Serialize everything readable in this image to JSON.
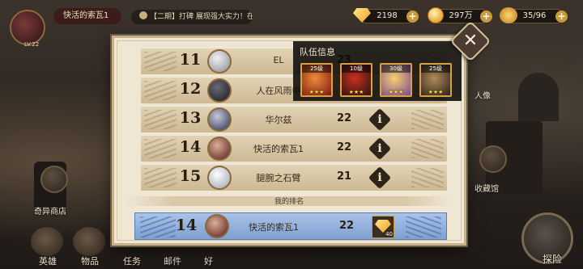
{
  "top": {
    "player_name": "快活的索瓦1",
    "player_level": "LV.22",
    "marquee": "【二期】打碑 展现强大实力！在"
  },
  "resources": [
    {
      "icon": "gem-icon",
      "value": "2198"
    },
    {
      "icon": "gold-coin-icon",
      "value": "297万"
    },
    {
      "icon": "stamina-icon",
      "value": "35/96"
    }
  ],
  "side_left": [
    {
      "label": "奇异商店"
    }
  ],
  "side_right": [
    {
      "label": "收藏馆"
    },
    {
      "label": "人像"
    }
  ],
  "bottom_bar": [
    {
      "label": "英雄"
    },
    {
      "label": "物品"
    },
    {
      "label": "任务"
    },
    {
      "label": "邮件"
    },
    {
      "label": "好"
    }
  ],
  "explore_label": "探险",
  "ranking": {
    "rows": [
      {
        "rank": "11",
        "name": "EL",
        "score": "23",
        "avatar_color": "#c8c8d0"
      },
      {
        "rank": "12",
        "name": "人在风雨中",
        "score": "",
        "avatar_color": "#3a3a44"
      },
      {
        "rank": "13",
        "name": "华尔兹",
        "score": "22",
        "avatar_color": "#5a6a8a"
      },
      {
        "rank": "14",
        "name": "快活的索瓦1",
        "score": "22",
        "avatar_color": "#7a2a2a"
      },
      {
        "rank": "15",
        "name": "腿腕之石臂",
        "score": "21",
        "avatar_color": "#d0d0d8"
      }
    ],
    "info_label": "i",
    "my_rank_label": "我的排名",
    "my_row": {
      "rank": "14",
      "name": "快活的索瓦1",
      "score": "22",
      "reward_count": "40"
    }
  },
  "team_popover": {
    "title": "队伍信息",
    "heroes": [
      {
        "level": "25级",
        "stars": "★★★",
        "color_a": "#e85a2a",
        "color_b": "#7a1a10"
      },
      {
        "level": "10级",
        "stars": "★★★",
        "color_a": "#c83020",
        "color_b": "#2a1210"
      },
      {
        "level": "30级",
        "stars": "★★★",
        "color_a": "#f0c050",
        "color_b": "#7a4a90"
      },
      {
        "level": "25级",
        "stars": "★★★",
        "color_a": "#8a6a4a",
        "color_b": "#2a221a"
      }
    ]
  },
  "close_label": "✕"
}
